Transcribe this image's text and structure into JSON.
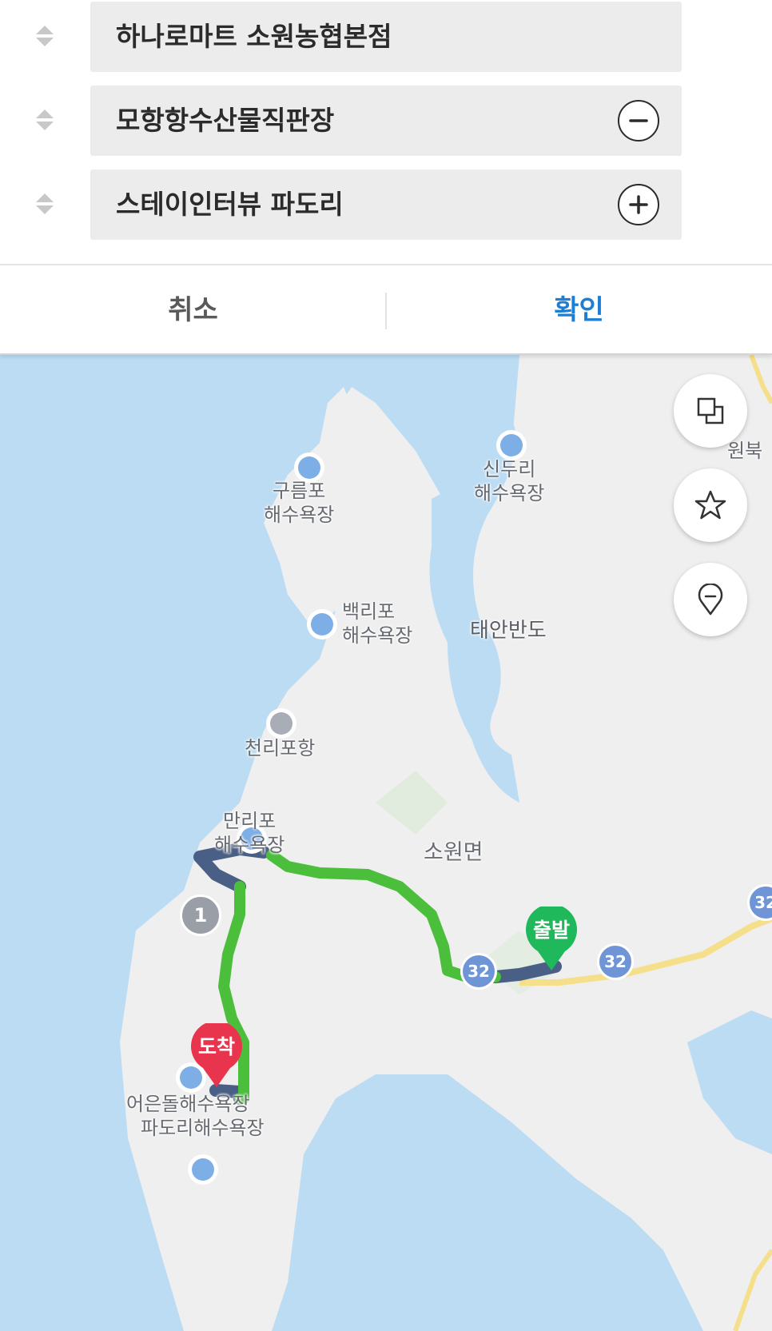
{
  "stops": [
    {
      "name": "하나로마트 소원농협본점",
      "action": ""
    },
    {
      "name": "모항항수산물직판장",
      "action": "minus"
    },
    {
      "name": "스테이인터뷰 파도리",
      "action": "plus"
    }
  ],
  "actions": {
    "cancel": "취소",
    "confirm": "확인"
  },
  "colors": {
    "accent": "#1c7fd6",
    "route_green": "#4bbf3c",
    "route_congested": "#4a5f85",
    "start": "#1fb85a",
    "end": "#e8344d"
  },
  "map": {
    "labels": {
      "gureumpo": "구름포\n해수욕장",
      "sinduri": "신두리\n해수욕장",
      "baekripo": "백리포\n해수욕장",
      "taean": "태안반도",
      "cheollipo": "천리포항",
      "mallipo": "만리포\n해수욕장",
      "sowon": "소원면",
      "eoeundol": "어은돌해수욕장",
      "padori": "파도리해수욕장",
      "wonbuk": "원북"
    },
    "road_number": "32",
    "waypoint": "1",
    "start_marker": "출발",
    "end_marker": "도착",
    "buttons": [
      "layers-icon",
      "star-icon",
      "location-pin-icon"
    ]
  }
}
